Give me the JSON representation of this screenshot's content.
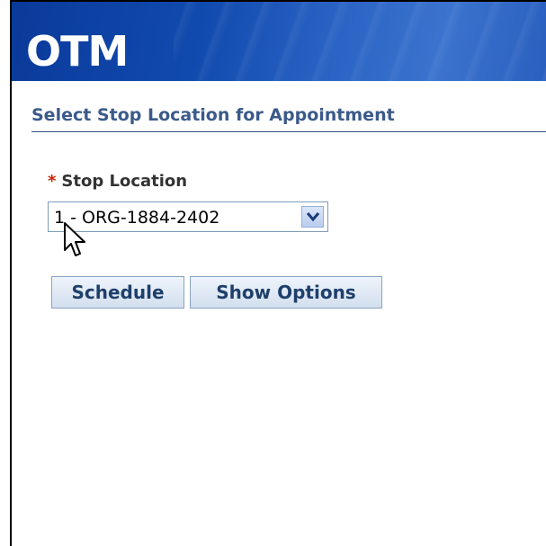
{
  "banner": {
    "title": "OTM"
  },
  "section": {
    "title": "Select Stop Location for Appointment"
  },
  "form": {
    "required_marker": "*",
    "stop_location_label": "Stop Location",
    "stop_location_value": "1 - ORG-1884-2402"
  },
  "buttons": {
    "schedule_label": "Schedule",
    "show_options_label": "Show Options"
  },
  "icons": {
    "dropdown": "chevron-down-icon",
    "cursor": "mouse-pointer-icon"
  },
  "colors": {
    "banner": "#114aae",
    "section_title": "#3b5a8a",
    "required": "#cc2200",
    "button_text": "#1e3f6b"
  }
}
